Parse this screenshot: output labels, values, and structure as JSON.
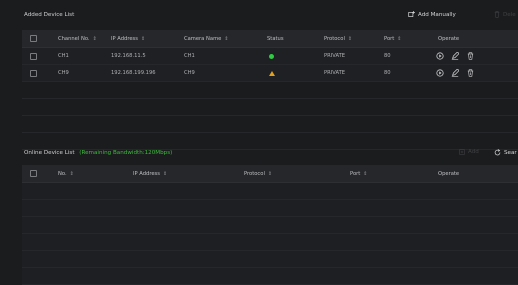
{
  "added": {
    "title": "Added Device List",
    "add_manually": "Add Manually",
    "delete": "Dele",
    "columns": {
      "channel": "Channel No.",
      "ip": "IP Address",
      "camera": "Camera Name",
      "status": "Status",
      "protocol": "Protocol",
      "port": "Port",
      "operate": "Operate"
    },
    "sort_glyph": "⇕",
    "rows": [
      {
        "channel": "CH1",
        "ip": "192.168.11.5",
        "camera": "CH1",
        "status": "online",
        "protocol": "PRIVATE",
        "port": "80"
      },
      {
        "channel": "CH9",
        "ip": "192.168.199.196",
        "camera": "CH9",
        "status": "warning",
        "protocol": "PRIVATE",
        "port": "80"
      }
    ]
  },
  "online": {
    "title": "Online Device List",
    "bandwidth": "(Remaining Bandwidth:120Mbps)",
    "add": "Add",
    "search": "Sear",
    "columns": {
      "no": "No.",
      "ip": "IP Address",
      "protocol": "Protocol",
      "port": "Port",
      "operate": "Operate"
    },
    "sort_glyph": "⇕"
  },
  "colors": {
    "online": "#2ecc40",
    "warning": "#e0a020",
    "bandwidth": "#3dbd3d"
  },
  "icons": {
    "add_manually": "add-device-icon",
    "delete": "trash-icon",
    "add": "add-icon",
    "search": "refresh-search-icon",
    "operate": [
      "play-circle-icon",
      "edit-icon",
      "trash-icon"
    ]
  }
}
